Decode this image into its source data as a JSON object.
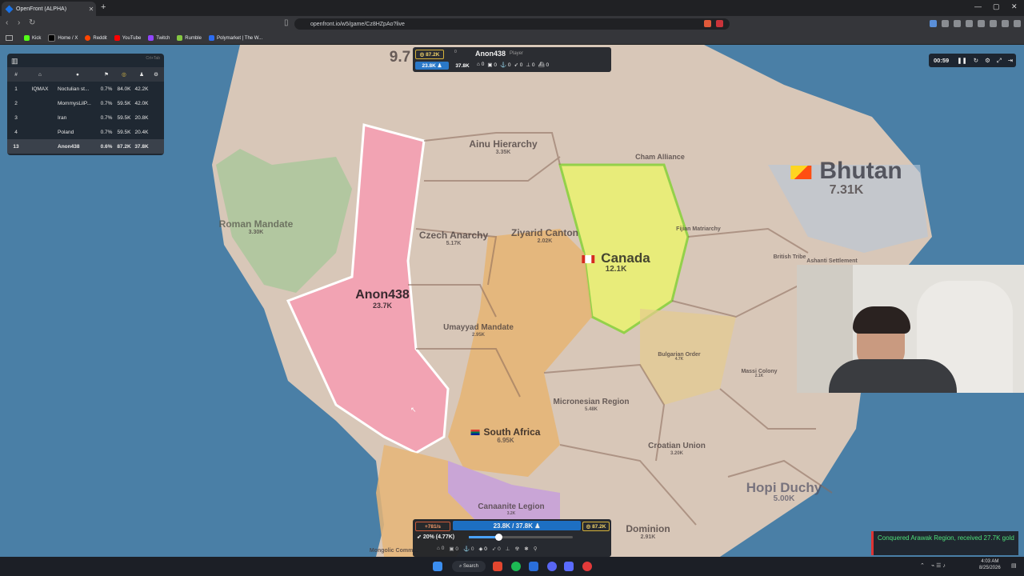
{
  "browser": {
    "tab_title": "OpenFront (ALPHA)",
    "url": "openfront.io/w5/game/Cz8HZpAo?live",
    "bookmarks": [
      "Kick",
      "Home / X",
      "Reddit",
      "YouTube",
      "Twitch",
      "Rumble",
      "Polymarket | The W..."
    ]
  },
  "leaderboard": {
    "corner_text": "Crt+Tab",
    "header": {
      "rank": "#"
    },
    "rows": [
      {
        "rank": "1",
        "clan": "IQMAX",
        "name": "Noctulian st...",
        "territory": "0.7%",
        "gold": "84.0K",
        "troops": "42.2K"
      },
      {
        "rank": "2",
        "clan": "",
        "name": "MommysLilP...",
        "territory": "0.7%",
        "gold": "59.5K",
        "troops": "42.0K"
      },
      {
        "rank": "3",
        "clan": "",
        "name": "Iran",
        "territory": "0.7%",
        "gold": "59.5K",
        "troops": "20.8K"
      },
      {
        "rank": "4",
        "clan": "",
        "name": "Poland",
        "territory": "0.7%",
        "gold": "59.5K",
        "troops": "20.4K"
      },
      {
        "rank": "13",
        "clan": "",
        "name": "Anon438",
        "territory": "0.6%",
        "gold": "87.2K",
        "troops": "37.8K"
      }
    ]
  },
  "topbar": {
    "gold": "87.2K",
    "troops": "23.8K",
    "max_troops": "37.8K",
    "small_top": "0",
    "player_name": "Anon438",
    "player_tag": "Player",
    "counters": [
      "0",
      "0",
      "0",
      "0",
      "0",
      "0"
    ]
  },
  "timer": {
    "time": "00:59"
  },
  "map_labels": [
    {
      "name": "9.7",
      "value": ""
    },
    {
      "name": "Ainu Hierarchy",
      "value": "3.35K"
    },
    {
      "name": "Cham Alliance",
      "value": ""
    },
    {
      "name": "Bhutan",
      "value": "7.31K"
    },
    {
      "name": "Roman Mandate",
      "value": "3.30K"
    },
    {
      "name": "Czech Anarchy",
      "value": "5.17K"
    },
    {
      "name": "Ziyarid Canton",
      "value": "2.02K"
    },
    {
      "name": "Canada",
      "value": "12.1K"
    },
    {
      "name": "Fijian Matriarchy",
      "value": ""
    },
    {
      "name": "British Tribe",
      "value": ""
    },
    {
      "name": "Ashanti Settlement",
      "value": ""
    },
    {
      "name": "Anon438",
      "value": "23.7K"
    },
    {
      "name": "Umayyad Mandate",
      "value": "2.95K"
    },
    {
      "name": "Bulgarian Order",
      "value": "4.7K"
    },
    {
      "name": "Massi Colony",
      "value": "2.1K"
    },
    {
      "name": "Micronesian Region",
      "value": "5.48K"
    },
    {
      "name": "South Africa",
      "value": "6.95K"
    },
    {
      "name": "Croatian Union",
      "value": "3.20K"
    },
    {
      "name": "Hopi Duchy",
      "value": "5.00K"
    },
    {
      "name": "Canaanite Legion",
      "value": "3.2K"
    },
    {
      "name": "Dominion",
      "value": "2.91K"
    },
    {
      "name": "Mongolic Comm...",
      "value": ""
    }
  ],
  "bottom": {
    "income": "+781/s",
    "troops": "23.8K / 37.8K",
    "gold": "87.2K",
    "attack_ratio": "20% (4.77K)",
    "counters": [
      "0",
      "0",
      "0",
      "0",
      "0"
    ]
  },
  "toast": {
    "text": "Conquered Arawak Region, received 27.7K gold"
  },
  "taskbar": {
    "search": "Search",
    "time": "4:03 AM",
    "date": "8/25/2026"
  },
  "colors": {
    "player": "#f2a3b3",
    "canada": "#e8ec7a",
    "south_africa": "#e6b577",
    "canaanite": "#c9a5d6",
    "ocean": "#4a7fa6",
    "land": "#d7c6b7"
  }
}
